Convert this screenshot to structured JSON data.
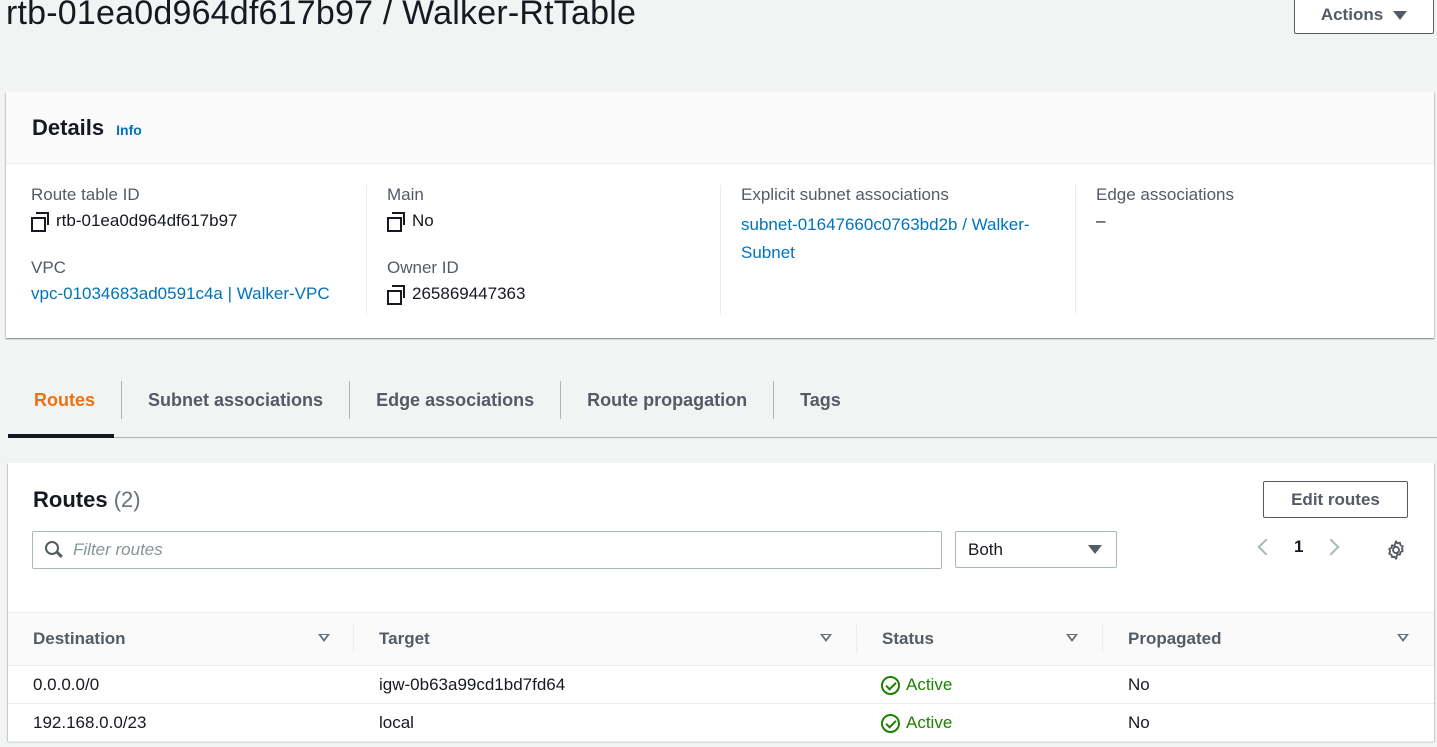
{
  "header": {
    "title": "rtb-01ea0d964df617b97 / Walker-RtTable",
    "actions_label": "Actions"
  },
  "details": {
    "title": "Details",
    "info_label": "Info",
    "route_table_id_label": "Route table ID",
    "route_table_id": "rtb-01ea0d964df617b97",
    "vpc_label": "VPC",
    "vpc": "vpc-01034683ad0591c4a | Walker-VPC",
    "main_label": "Main",
    "main": "No",
    "owner_id_label": "Owner ID",
    "owner_id": "265869447363",
    "explicit_subnet_label": "Explicit subnet associations",
    "explicit_subnet_line1": "subnet-01647660c0763bd2b / Walker-",
    "explicit_subnet_line2": "Subnet",
    "edge_assoc_label": "Edge associations",
    "edge_assoc": "–"
  },
  "tabs": [
    {
      "label": "Routes",
      "active": true
    },
    {
      "label": "Subnet associations",
      "active": false
    },
    {
      "label": "Edge associations",
      "active": false
    },
    {
      "label": "Route propagation",
      "active": false
    },
    {
      "label": "Tags",
      "active": false
    }
  ],
  "routes": {
    "title": "Routes",
    "count": "(2)",
    "edit_label": "Edit routes",
    "filter_placeholder": "Filter routes",
    "select_value": "Both",
    "page": "1",
    "columns": [
      "Destination",
      "Target",
      "Status",
      "Propagated"
    ],
    "rows": [
      {
        "destination": "0.0.0.0/0",
        "target": "igw-0b63a99cd1bd7fd64",
        "target_is_link": true,
        "status": "Active",
        "propagated": "No"
      },
      {
        "destination": "192.168.0.0/23",
        "target": "local",
        "target_is_link": false,
        "status": "Active",
        "propagated": "No"
      }
    ]
  },
  "colors": {
    "link": "#0073bb",
    "active_tab": "#ec7211",
    "status_ok": "#1d8102"
  }
}
